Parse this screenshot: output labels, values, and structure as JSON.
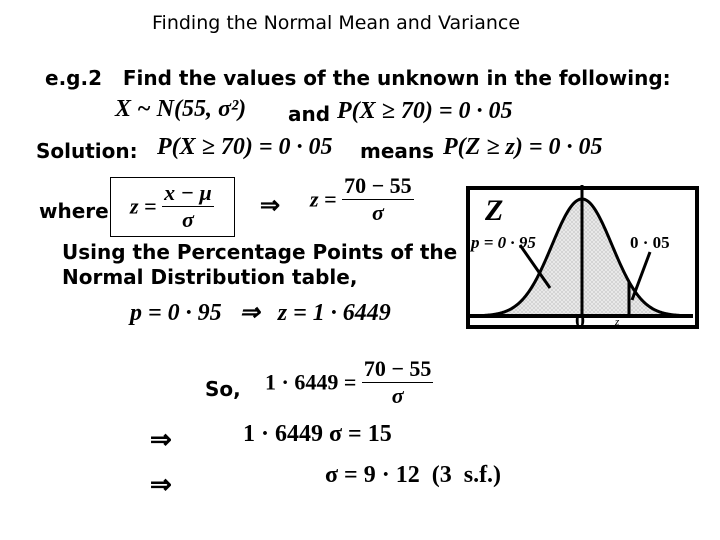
{
  "title": "Finding the Normal Mean and Variance",
  "question": {
    "label": "e.g.2",
    "text": "Find the values of the unknown in the following:",
    "given_distribution": "X ~ N(55, σ²)",
    "connector": "and",
    "given_probability": "P(X ≥ 70) = 0 · 05"
  },
  "solution": {
    "label": "Solution:",
    "statement": "P(X ≥ 70) = 0 · 05",
    "means_label": "means",
    "z_statement": "P(Z ≥ z) = 0 · 05",
    "where_label": "where",
    "formula": {
      "lhs": "z =",
      "numerator": "x − μ",
      "denominator": "σ"
    },
    "implies_symbol": "⇒",
    "substituted": {
      "lhs": "z =",
      "numerator": "70 − 55",
      "denominator": "σ"
    },
    "table_text_line1": "Using the Percentage Points of the",
    "table_text_line2": "Normal Distribution table,",
    "table_lookup": "p = 0 · 95   ⇒   z = 1 · 6449",
    "so_label": "So,",
    "step1": {
      "lhs": "1 · 6449 =",
      "numerator": "70 − 55",
      "denominator": "σ"
    },
    "step2": "1 · 6449 σ = 15",
    "step3": "σ = 9 · 12  (3  s.f.)"
  },
  "diagram": {
    "variable_label": "Z",
    "left_area_label": "p = 0 · 95",
    "right_tail_label": "0 · 05",
    "mean_label": "0",
    "z_label": "z",
    "shade_color": "#d4d4d4"
  }
}
